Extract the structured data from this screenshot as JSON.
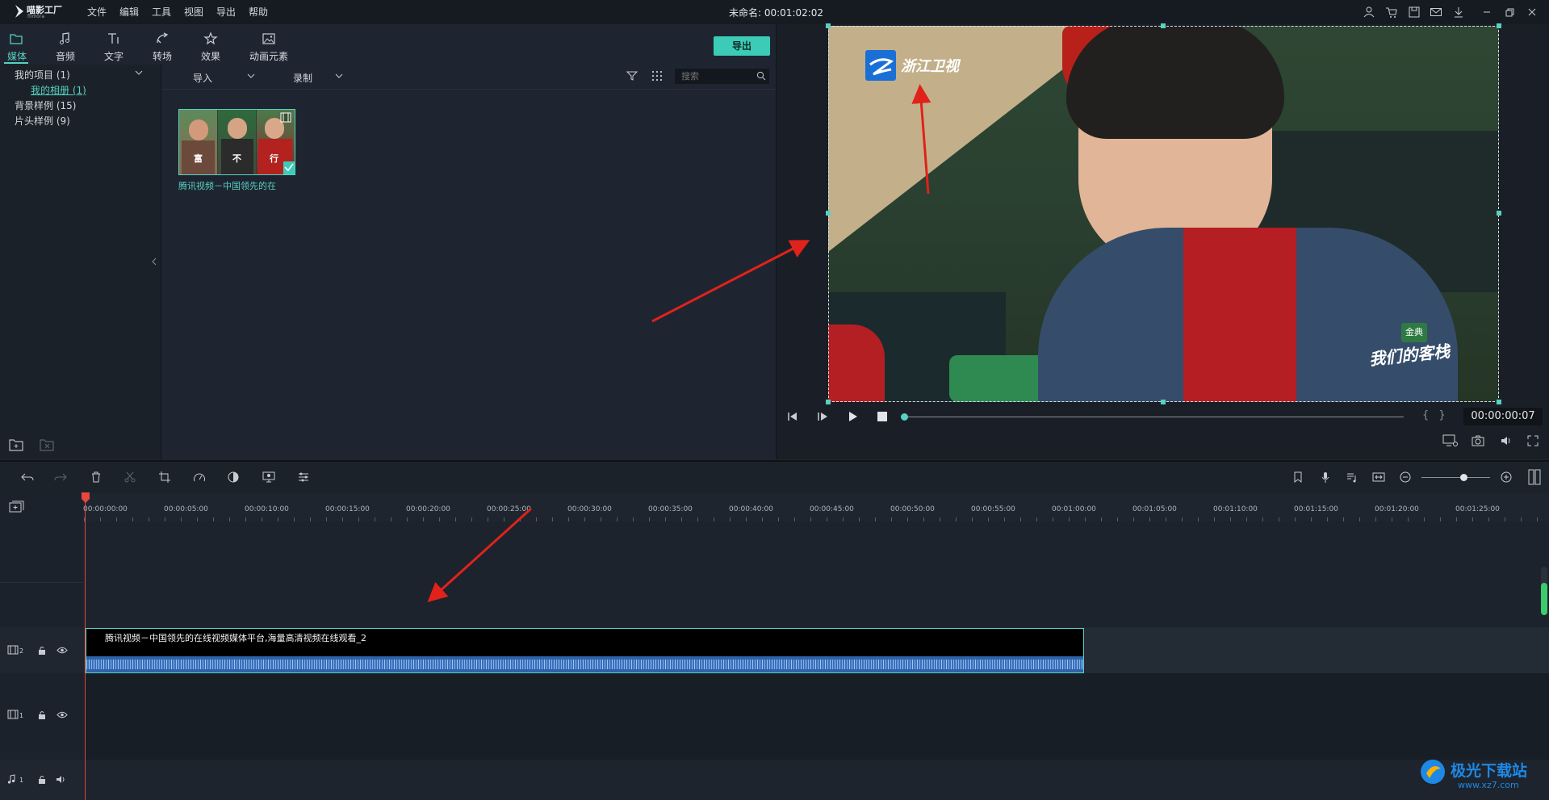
{
  "app": {
    "logo_text": "喵影工厂",
    "logo_sub": "filmora",
    "window_title": "未命名: 00:01:02:02"
  },
  "menu": [
    "文件",
    "编辑",
    "工具",
    "视图",
    "导出",
    "帮助"
  ],
  "tabs": [
    {
      "label": "媒体",
      "icon": "folder-icon",
      "active": true
    },
    {
      "label": "音频",
      "icon": "music-note-icon"
    },
    {
      "label": "文字",
      "icon": "text-icon"
    },
    {
      "label": "转场",
      "icon": "transition-icon"
    },
    {
      "label": "效果",
      "icon": "effects-icon"
    },
    {
      "label": "动画元素",
      "icon": "image-icon"
    }
  ],
  "export_label": "导出",
  "sidebar": {
    "items": [
      {
        "label": "我的项目 (1)"
      },
      {
        "label": "我的相册 (1)"
      },
      {
        "label": "背景样例 (15)"
      },
      {
        "label": "片头样例 (9)"
      }
    ]
  },
  "media_toolbar": {
    "import_label": "导入",
    "record_label": "录制",
    "search_placeholder": "搜索"
  },
  "media_item": {
    "label": "腾讯视频－中国领先的在",
    "thumb_captions": [
      "富",
      "不",
      "行"
    ]
  },
  "preview": {
    "watermark_text": "浙江卫视",
    "show_logo_top": "金典",
    "show_logo_text": "我们的客栈",
    "time": "00:00:00:07",
    "bracket_text": "{ }"
  },
  "timeline": {
    "ticks": [
      "00:00:00:00",
      "00:00:05:00",
      "00:00:10:00",
      "00:00:15:00",
      "00:00:20:00",
      "00:00:25:00",
      "00:00:30:00",
      "00:00:35:00",
      "00:00:40:00",
      "00:00:45:00",
      "00:00:50:00",
      "00:00:55:00",
      "00:01:00:00",
      "00:01:05:00",
      "00:01:10:00",
      "00:01:15:00",
      "00:01:20:00",
      "00:01:25:00"
    ],
    "clip_label": "腾讯视频－中国领先的在线视频媒体平台,海量高清视频在线观看_2",
    "tracks": [
      {
        "number": "2",
        "type": "video"
      },
      {
        "number": "1",
        "type": "video"
      },
      {
        "number": "1",
        "type": "audio"
      }
    ]
  },
  "site_watermark": {
    "text": "极光下载站",
    "url": "www.xz7.com"
  },
  "colors": {
    "accent": "#57d1c2",
    "annotation_arrow": "#e0221b"
  }
}
